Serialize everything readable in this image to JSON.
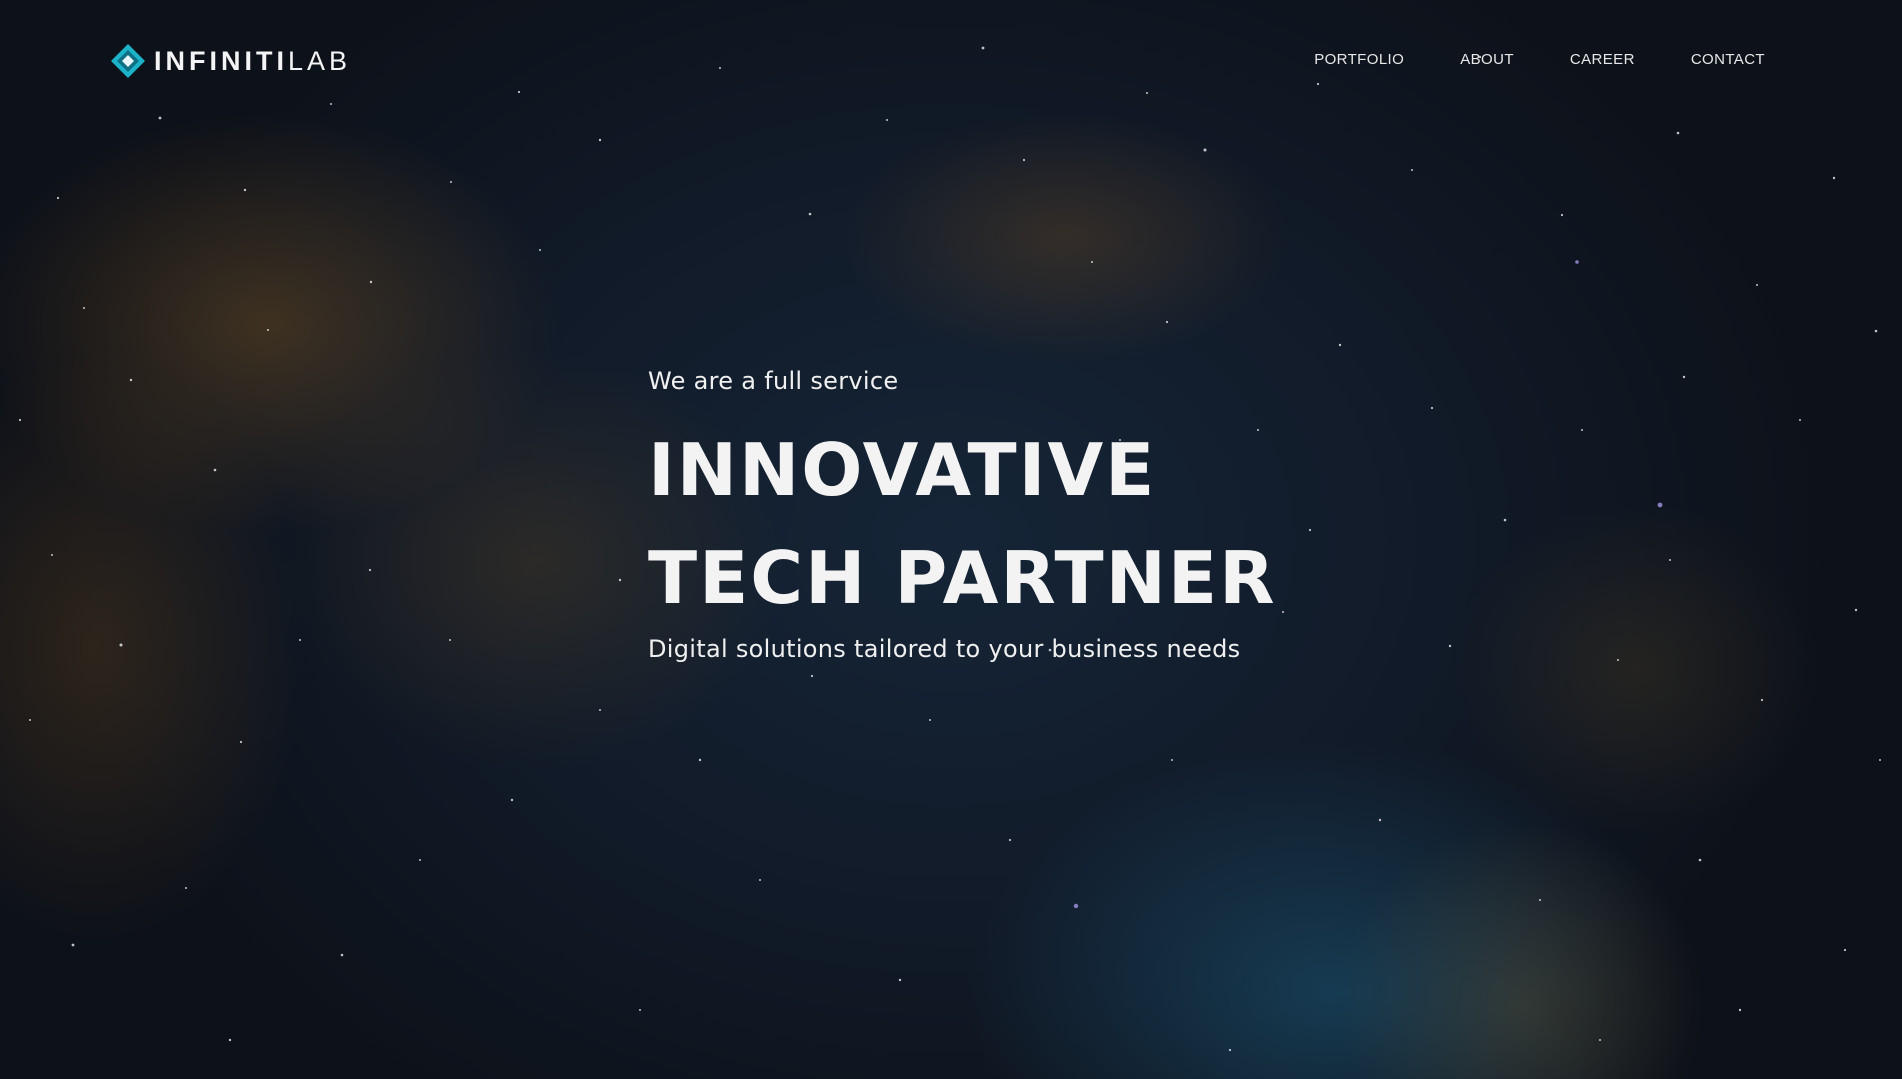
{
  "brand": {
    "name_strong": "INFINITI",
    "name_light": "LAB",
    "logo_icon": "diamond-logo-icon",
    "accent_color": "#1ab3c8"
  },
  "nav": {
    "items": [
      {
        "label": "PORTFOLIO"
      },
      {
        "label": "ABOUT"
      },
      {
        "label": "CAREER"
      },
      {
        "label": "CONTACT"
      }
    ]
  },
  "hero": {
    "eyebrow": "We are a full service",
    "title_line1": "INNOVATIVE",
    "title_line2": "TECH PARTNER",
    "tagline": "Digital solutions tailored to your business needs"
  },
  "theme": {
    "background": "#111a28",
    "text": "#f2f2f2"
  }
}
